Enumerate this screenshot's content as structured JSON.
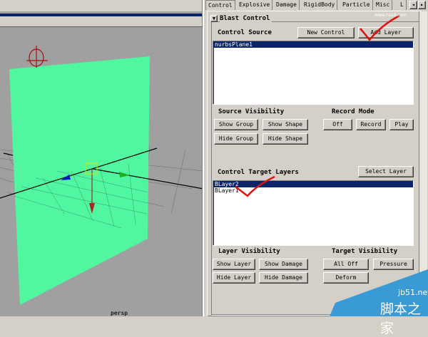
{
  "viewport": {
    "camera_label": "persp",
    "plane_color": "#4cfba0"
  },
  "tabs": [
    "Control",
    "Explosive",
    "Damage",
    "RigidBody",
    "Particle",
    "Misc",
    "L"
  ],
  "frame": {
    "title": "Blast Control"
  },
  "control_source": {
    "label": "Control Source",
    "new_control": "New Control",
    "add_layer": "Add Layer",
    "items": [
      "nurbsPlane1"
    ]
  },
  "source_visibility": {
    "label": "Source Visibility",
    "show_group": "Show Group",
    "show_shape": "Show Shape",
    "hide_group": "Hide Group",
    "hide_shape": "Hide Shape"
  },
  "record_mode": {
    "label": "Record Mode",
    "off": "Off",
    "record": "Record",
    "play": "Play"
  },
  "target_layers": {
    "label": "Control Target Layers",
    "select_layer": "Select Layer",
    "items": [
      "BLayer2",
      "BLayer1"
    ]
  },
  "layer_visibility": {
    "label": "Layer Visibility",
    "show_layer": "Show Layer",
    "show_damage": "Show Damage",
    "hide_layer": "Hide Layer",
    "hide_damage": "Hide Damage"
  },
  "target_visibility": {
    "label": "Target Visibility",
    "all_off": "All Off",
    "pressure": "Pressure",
    "deform": "Deform"
  },
  "watermark": {
    "site": "jb51.net",
    "name": "脚本之家",
    "top": "www.hxsd.com"
  }
}
